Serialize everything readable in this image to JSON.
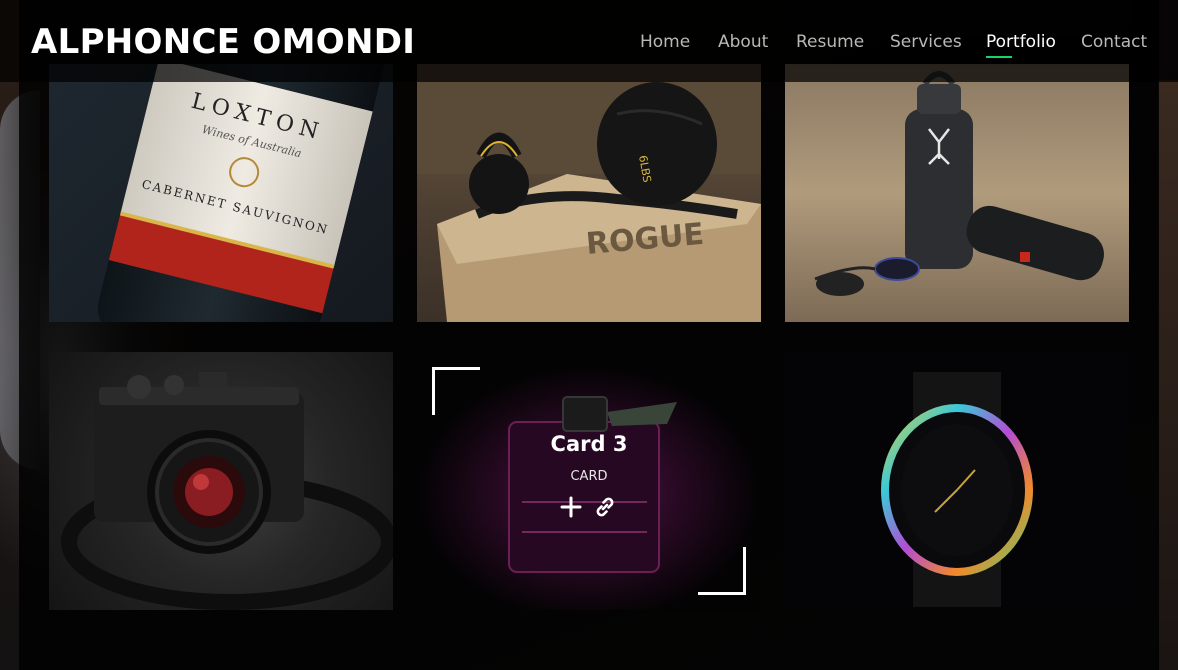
{
  "header": {
    "logo": "ALPHONCE OMONDI",
    "nav": [
      {
        "label": "Home",
        "active": false
      },
      {
        "label": "About",
        "active": false
      },
      {
        "label": "Resume",
        "active": false
      },
      {
        "label": "Services",
        "active": false
      },
      {
        "label": "Portfolio",
        "active": true
      },
      {
        "label": "Contact",
        "active": false
      }
    ]
  },
  "colors": {
    "accent": "#18d26e",
    "background": "#000000",
    "text": "#ffffff",
    "nav_text": "#b8b8b8"
  },
  "portfolio": {
    "items": [
      {
        "image": "wine-bottle",
        "label_lines": [
          "LOXTON",
          "Wines of Australia",
          "CABERNET SAUVIGNON"
        ]
      },
      {
        "image": "kettlebell-and-medicine-ball",
        "label_lines": [
          "ROGUE",
          "6LBS"
        ]
      },
      {
        "image": "water-bottle-and-speaker"
      },
      {
        "image": "camera"
      },
      {
        "image": "perfume-bottle",
        "title": "Card 3",
        "subtitle": "CARD",
        "hovered": true,
        "actions": [
          "plus-icon",
          "link-icon"
        ]
      },
      {
        "image": "watch"
      }
    ]
  }
}
